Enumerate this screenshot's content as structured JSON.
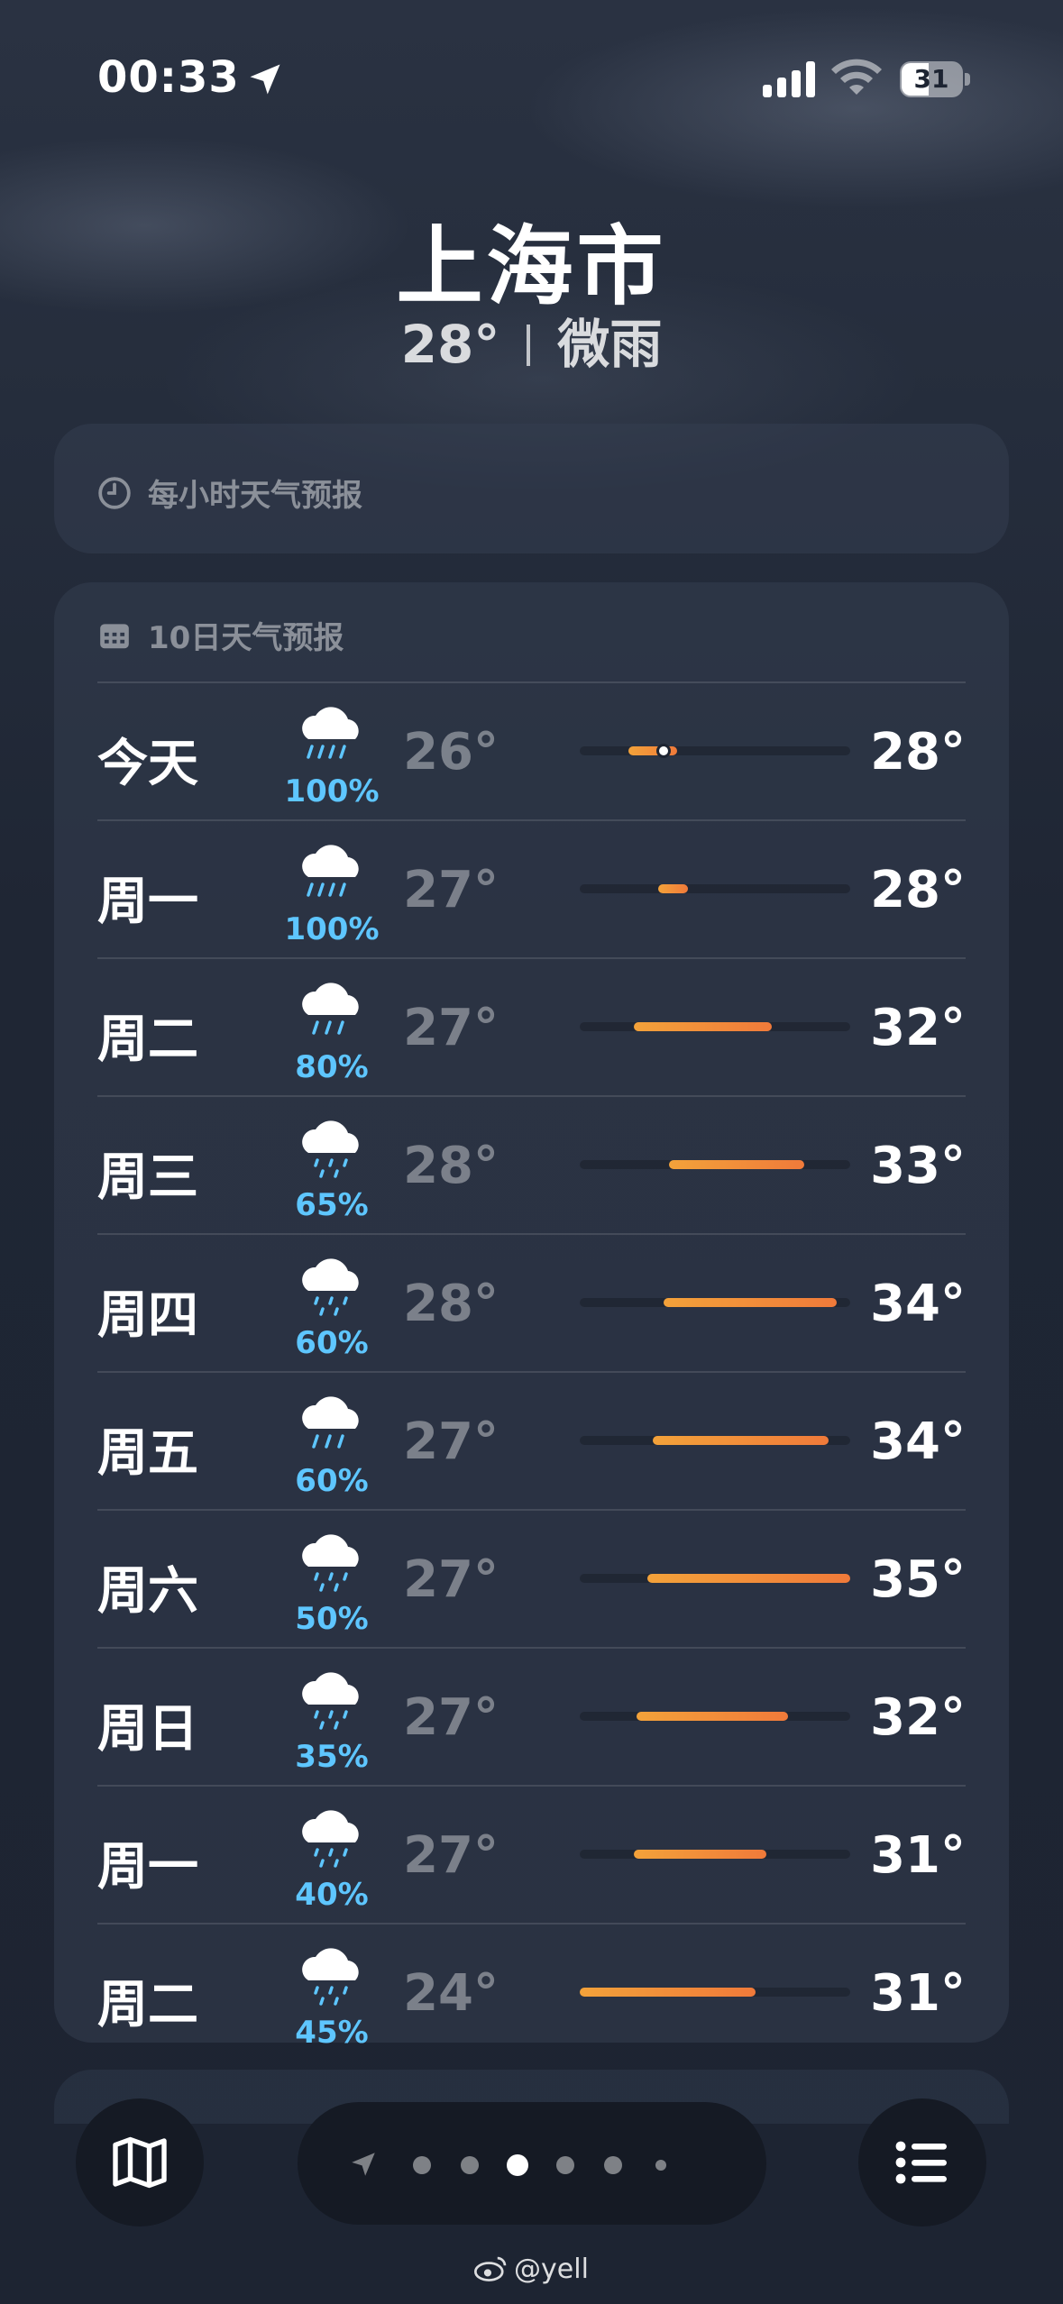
{
  "status_bar": {
    "time": "00:33",
    "battery": "31"
  },
  "header": {
    "city": "上海市",
    "temperature": "28°",
    "condition": "微雨"
  },
  "hourly_card": {
    "title": "每小时天气预报"
  },
  "daily_card": {
    "title": "10日天气预报",
    "days": [
      {
        "day": "今天",
        "precip": "100%",
        "low": "26°",
        "high": "28°",
        "icon": "heavy-rain-icon",
        "bar_start": 0.18,
        "bar_end": 0.36,
        "current": 0.31
      },
      {
        "day": "周一",
        "precip": "100%",
        "low": "27°",
        "high": "28°",
        "icon": "heavy-rain-icon",
        "bar_start": 0.29,
        "bar_end": 0.4
      },
      {
        "day": "周二",
        "precip": "80%",
        "low": "27°",
        "high": "32°",
        "icon": "rain-icon",
        "bar_start": 0.2,
        "bar_end": 0.71
      },
      {
        "day": "周三",
        "precip": "65%",
        "low": "28°",
        "high": "33°",
        "icon": "drizzle-icon",
        "bar_start": 0.33,
        "bar_end": 0.83
      },
      {
        "day": "周四",
        "precip": "60%",
        "low": "28°",
        "high": "34°",
        "icon": "drizzle-icon",
        "bar_start": 0.31,
        "bar_end": 0.95
      },
      {
        "day": "周五",
        "precip": "60%",
        "low": "27°",
        "high": "34°",
        "icon": "rain-icon",
        "bar_start": 0.27,
        "bar_end": 0.92
      },
      {
        "day": "周六",
        "precip": "50%",
        "low": "27°",
        "high": "35°",
        "icon": "drizzle-icon",
        "bar_start": 0.25,
        "bar_end": 1.0
      },
      {
        "day": "周日",
        "precip": "35%",
        "low": "27°",
        "high": "32°",
        "icon": "drizzle-icon",
        "bar_start": 0.21,
        "bar_end": 0.77
      },
      {
        "day": "周一",
        "precip": "40%",
        "low": "27°",
        "high": "31°",
        "icon": "drizzle-icon",
        "bar_start": 0.2,
        "bar_end": 0.69
      },
      {
        "day": "周二",
        "precip": "45%",
        "low": "24°",
        "high": "31°",
        "icon": "drizzle-icon",
        "bar_start": 0.0,
        "bar_end": 0.65
      }
    ]
  },
  "toolbar": {
    "page_count": 6,
    "active_page": 2
  },
  "watermark": "@yell",
  "colors": {
    "temp_bar_start": "#f3a23a",
    "temp_bar_end": "#f07a3a",
    "precip": "#5ec6ff"
  }
}
